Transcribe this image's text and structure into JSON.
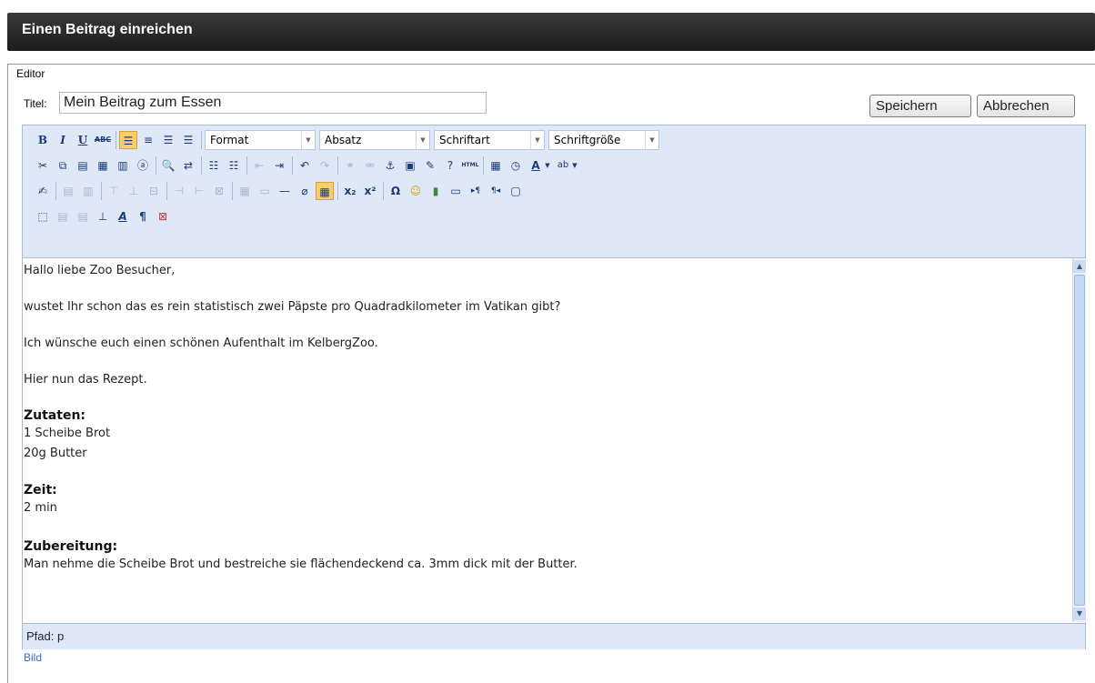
{
  "page": {
    "title": "Einen Beitrag einreichen"
  },
  "form": {
    "legend": "Editor",
    "title_label": "Titel:",
    "title_value": "Mein Beitrag zum Essen",
    "save_label": "Speichern",
    "cancel_label": "Abbrechen"
  },
  "toolbar": {
    "row1": {
      "bold": "B",
      "italic": "I",
      "underline": "U",
      "strike": "ABC",
      "format": "Format",
      "paragraph": "Absatz",
      "font": "Schriftart",
      "fontsize": "Schriftgröße"
    },
    "html_label": "HTML"
  },
  "content": {
    "greeting": "Hallo liebe Zoo Besucher,",
    "line2": "wustet Ihr schon das es rein statistisch zwei Päpste pro Quadradkilometer im Vatikan gibt?",
    "line3": "Ich wünsche euch einen schönen Aufenthalt im KelbergZoo.",
    "line4": "Hier nun das Rezept.",
    "zutaten_heading": "Zutaten:",
    "zutat1": "1 Scheibe Brot",
    "zutat2": "20g Butter",
    "zeit_heading": "Zeit:",
    "zeit_value": "2 min",
    "zubereitung_heading": "Zubereitung:",
    "zubereitung_text": "Man nehme die Scheibe Brot und bestreiche sie flächendeckend ca. 3mm dick mit der Butter."
  },
  "status": {
    "path": "Pfad: p"
  },
  "footer": {
    "link": "Bild"
  },
  "colors": {
    "header": "#2a2a2a",
    "toolbar": "#dfe8f6",
    "active": "#f7cf6a",
    "link": "#3a6abf"
  }
}
